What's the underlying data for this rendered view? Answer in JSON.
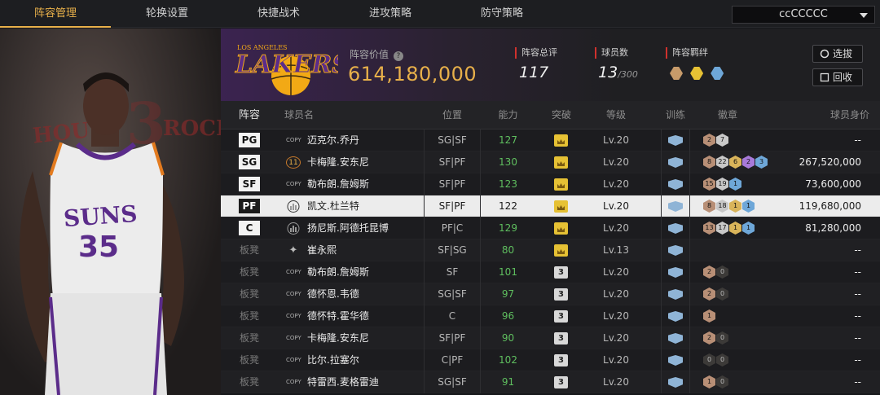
{
  "nav": {
    "tabs": [
      "阵容管理",
      "轮换设置",
      "快捷战术",
      "进攻策略",
      "防守策略"
    ],
    "active_tab": 0,
    "team_select": "ccCCCCC"
  },
  "header": {
    "logo_text": "LAKERS",
    "logo_sub": "LOS ANGELES",
    "value_label": "阵容价值",
    "value": "614,180,000",
    "rating_label": "阵容总评",
    "rating": "117",
    "count_label": "球员数",
    "count": "13",
    "count_max": "/300",
    "synergy_label": "阵容羁绊",
    "btn_select": "选拔",
    "btn_recycle": "回收"
  },
  "portrait": {
    "jersey_team": "SUNS",
    "jersey_number": "35",
    "bg_left": "HOUST",
    "bg_right": "ROCK"
  },
  "table": {
    "headers": [
      "阵容",
      "球员名",
      "位置",
      "能力",
      "突破",
      "等级",
      "训练",
      "徽章",
      "球员身价"
    ],
    "rows": [
      {
        "slot": "PG",
        "starter": true,
        "icon": "COPY",
        "name": "迈克尔.乔丹",
        "position": "SG|SF",
        "ability": "127",
        "break": "crown",
        "level": "Lv.20",
        "badges": [
          [
            "b-bronze",
            "2"
          ],
          [
            "b-silver",
            "7"
          ]
        ],
        "value": "--"
      },
      {
        "slot": "SG",
        "starter": true,
        "icon": "11",
        "name": "卡梅隆.安东尼",
        "position": "SF|PF",
        "ability": "130",
        "break": "crown",
        "level": "Lv.20",
        "badges": [
          [
            "b-bronze",
            "8"
          ],
          [
            "b-silver",
            "22"
          ],
          [
            "b-gold",
            "6"
          ],
          [
            "b-purple",
            "2"
          ],
          [
            "b-blue",
            "3"
          ]
        ],
        "value": "267,520,000"
      },
      {
        "slot": "SF",
        "starter": true,
        "icon": "COPY",
        "name": "勒布朗.詹姆斯",
        "position": "SF|PF",
        "ability": "123",
        "break": "crown",
        "level": "Lv.20",
        "badges": [
          [
            "b-bronze",
            "15"
          ],
          [
            "b-silver",
            "19"
          ],
          [
            "b-blue",
            "1"
          ]
        ],
        "value": "73,600,000"
      },
      {
        "slot": "PF",
        "starter": true,
        "icon": "bars",
        "name": "凯文.杜兰特",
        "position": "SF|PF",
        "ability": "122",
        "break": "crown",
        "level": "Lv.20",
        "badges": [
          [
            "b-bronze",
            "8"
          ],
          [
            "b-silver",
            "18"
          ],
          [
            "b-gold",
            "1"
          ],
          [
            "b-blue",
            "1"
          ]
        ],
        "value": "119,680,000"
      },
      {
        "slot": "C",
        "starter": true,
        "icon": "bars",
        "name": "扬尼斯.阿德托昆博",
        "position": "PF|C",
        "ability": "129",
        "break": "crown",
        "level": "Lv.20",
        "badges": [
          [
            "b-bronze",
            "13"
          ],
          [
            "b-silver",
            "17"
          ],
          [
            "b-gold",
            "1"
          ],
          [
            "b-blue",
            "1"
          ]
        ],
        "value": "81,280,000"
      },
      {
        "slot": "板凳",
        "starter": false,
        "icon": "star",
        "name": "崔永熙",
        "position": "SF|SG",
        "ability": "80",
        "break": "crown",
        "level": "Lv.13",
        "badges": [],
        "value": "--"
      },
      {
        "slot": "板凳",
        "starter": false,
        "icon": "COPY",
        "name": "勒布朗.詹姆斯",
        "position": "SF",
        "ability": "101",
        "break": "3",
        "level": "Lv.20",
        "badges": [
          [
            "b-bronze",
            "2"
          ],
          [
            "b-dark",
            "0"
          ]
        ],
        "value": "--"
      },
      {
        "slot": "板凳",
        "starter": false,
        "icon": "COPY",
        "name": "德怀恩.韦德",
        "position": "SG|SF",
        "ability": "97",
        "break": "3",
        "level": "Lv.20",
        "badges": [
          [
            "b-bronze",
            "2"
          ],
          [
            "b-dark",
            "0"
          ]
        ],
        "value": "--"
      },
      {
        "slot": "板凳",
        "starter": false,
        "icon": "COPY",
        "name": "德怀特.霍华德",
        "position": "C",
        "ability": "96",
        "break": "3",
        "level": "Lv.20",
        "badges": [
          [
            "b-bronze",
            "1"
          ]
        ],
        "value": "--"
      },
      {
        "slot": "板凳",
        "starter": false,
        "icon": "COPY",
        "name": "卡梅隆.安东尼",
        "position": "SF|PF",
        "ability": "90",
        "break": "3",
        "level": "Lv.20",
        "badges": [
          [
            "b-bronze",
            "2"
          ],
          [
            "b-dark",
            "0"
          ]
        ],
        "value": "--"
      },
      {
        "slot": "板凳",
        "starter": false,
        "icon": "COPY",
        "name": "比尔.拉塞尔",
        "position": "C|PF",
        "ability": "102",
        "break": "3",
        "level": "Lv.20",
        "badges": [
          [
            "b-dark",
            "0"
          ],
          [
            "b-dark",
            "0"
          ]
        ],
        "value": "--"
      },
      {
        "slot": "板凳",
        "starter": false,
        "icon": "COPY",
        "name": "特雷西.麦格雷迪",
        "position": "SG|SF",
        "ability": "91",
        "break": "3",
        "level": "Lv.20",
        "badges": [
          [
            "b-bronze",
            "1"
          ],
          [
            "b-dark",
            "0"
          ]
        ],
        "value": "--"
      }
    ],
    "selected_row": 3
  },
  "colors": {
    "accent": "#e8b04a",
    "green": "#5fbf5f",
    "red_marker": "#d0312d"
  }
}
